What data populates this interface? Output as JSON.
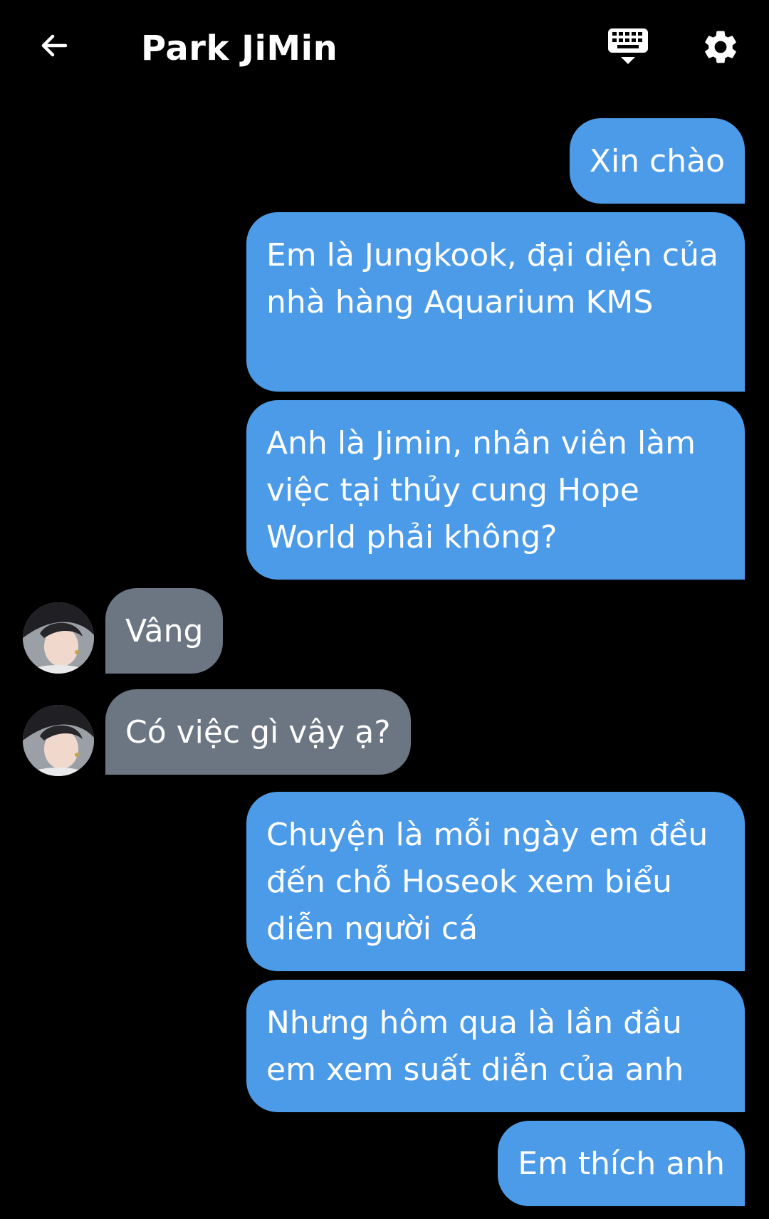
{
  "header": {
    "title": "Park JiMin",
    "icons": {
      "back": "arrow-back-icon",
      "keyboard": "keyboard-hide-icon",
      "settings": "gear-icon"
    }
  },
  "colors": {
    "background": "#000000",
    "outgoing_bubble": "#4c9be8",
    "incoming_bubble": "#6c7683",
    "text": "#ffffff"
  },
  "messages": [
    {
      "direction": "out",
      "text": "Xin chào"
    },
    {
      "direction": "out",
      "text": "Em là Jungkook, đại diện của nhà hàng Aquarium KMS"
    },
    {
      "direction": "out",
      "text": "Anh là Jimin, nhân viên làm việc tại thủy cung Hope World phải không?"
    },
    {
      "direction": "in",
      "text": "Vâng"
    },
    {
      "direction": "in",
      "text": "Có việc gì vậy ạ?"
    },
    {
      "direction": "out",
      "text": "Chuyện là mỗi ngày em đều đến chỗ Hoseok xem biểu diễn người cá"
    },
    {
      "direction": "out",
      "text": "Nhưng hôm qua là lần đầu em xem suất diễn của anh"
    },
    {
      "direction": "out",
      "text": "Em thích anh"
    }
  ]
}
